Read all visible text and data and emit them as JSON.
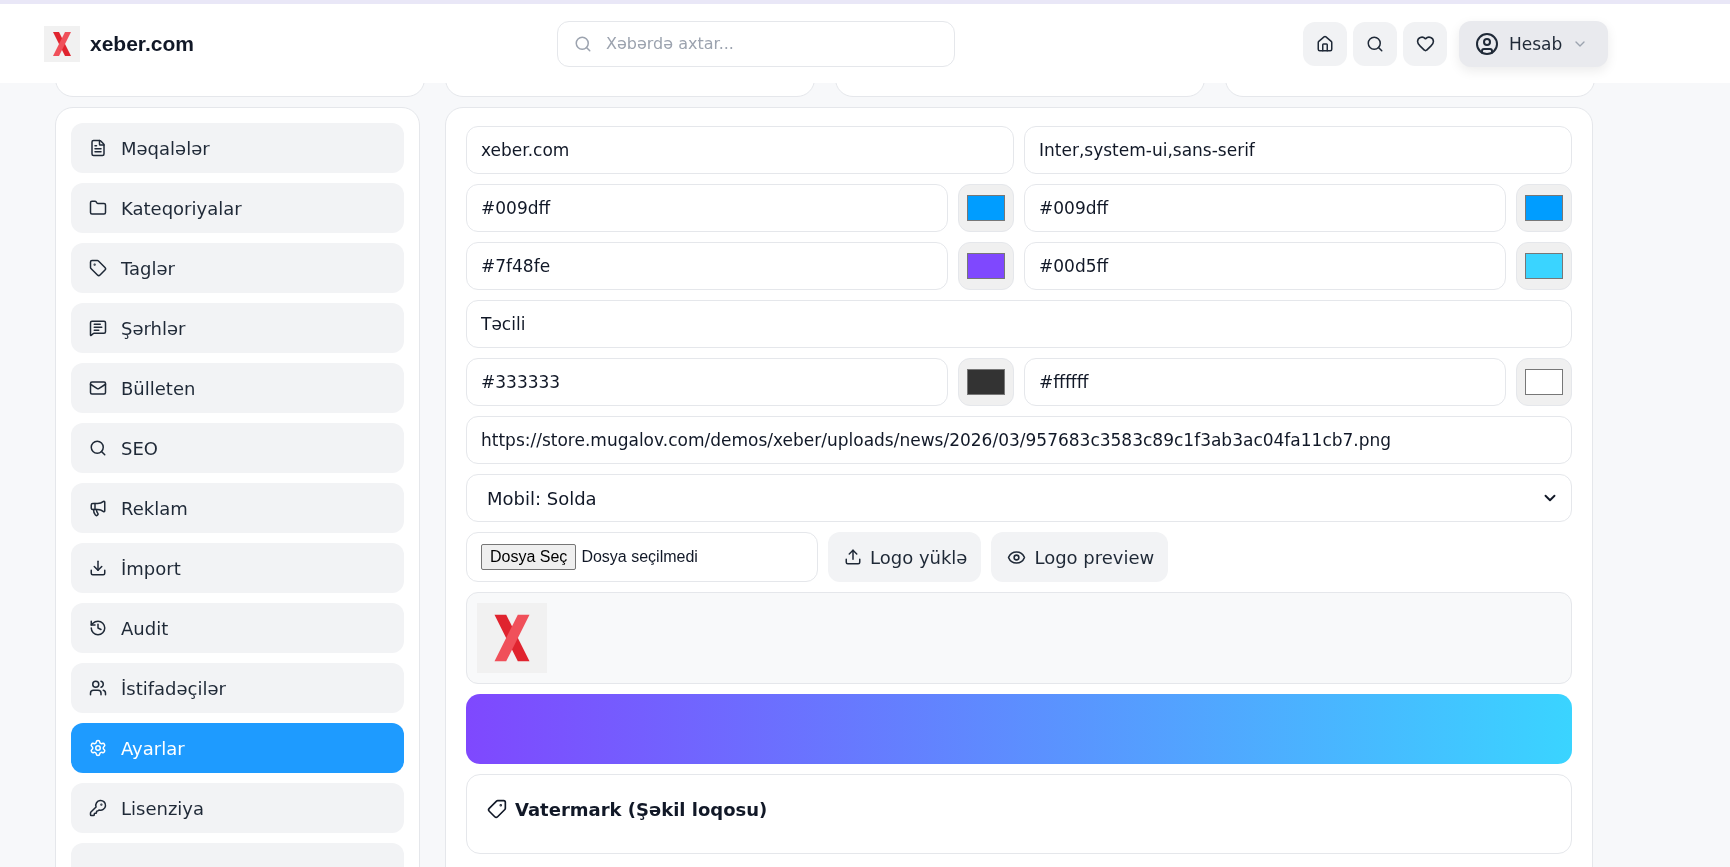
{
  "header": {
    "logo_text": "xeber.com",
    "search": {
      "placeholder": "Xəbərdə axtar..."
    },
    "account_button": "Hesab"
  },
  "sidebar": {
    "items": [
      {
        "label": "Məqalələr",
        "selected": false
      },
      {
        "label": "Kateqoriyalar",
        "selected": false
      },
      {
        "label": "Taglər",
        "selected": false
      },
      {
        "label": "Şərhlər",
        "selected": false
      },
      {
        "label": "Bülleten",
        "selected": false
      },
      {
        "label": "SEO",
        "selected": false
      },
      {
        "label": "Reklam",
        "selected": false
      },
      {
        "label": "İmport",
        "selected": false
      },
      {
        "label": "Audit",
        "selected": false
      },
      {
        "label": "İstifadəçilər",
        "selected": false
      },
      {
        "label": "Ayarlar",
        "selected": true
      },
      {
        "label": "Lisenziya",
        "selected": false
      }
    ]
  },
  "settings": {
    "rows": [
      {
        "kind": "text",
        "fields": [
          {
            "value": "xeber.com"
          },
          {
            "value": "Inter,system-ui,sans-serif"
          }
        ]
      },
      {
        "kind": "color",
        "fields": [
          {
            "value": "#009dff",
            "color": "#009dff"
          },
          {
            "value": "#009dff",
            "color": "#009dff"
          }
        ]
      },
      {
        "kind": "color",
        "fields": [
          {
            "value": "#7f48fe",
            "color": "#7f48fe"
          },
          {
            "value": "#00d5ff",
            "color": "#3ad4ff"
          }
        ]
      },
      {
        "kind": "text",
        "fields": [
          {
            "value": "Təcili"
          }
        ]
      },
      {
        "kind": "color",
        "fields": [
          {
            "value": "#333333",
            "color": "#333333"
          },
          {
            "value": "#ffffff",
            "color": "#ffffff"
          }
        ]
      },
      {
        "kind": "text",
        "fields": [
          {
            "value": "https://store.mugalov.com/demos/xeber/uploads/news/2026/03/957683c3583c89c1f3ab3ac04fa11cb7.png"
          }
        ]
      },
      {
        "kind": "select",
        "value": "Mobil: Solda"
      }
    ],
    "upload": {
      "file_button": "Dosya Seç",
      "file_status": "Dosya seçilmedi",
      "upload_button": "Logo yüklə",
      "preview_button": "Logo preview"
    },
    "watermark": {
      "title": "Vatermark (Şəkil loqosu)"
    }
  }
}
